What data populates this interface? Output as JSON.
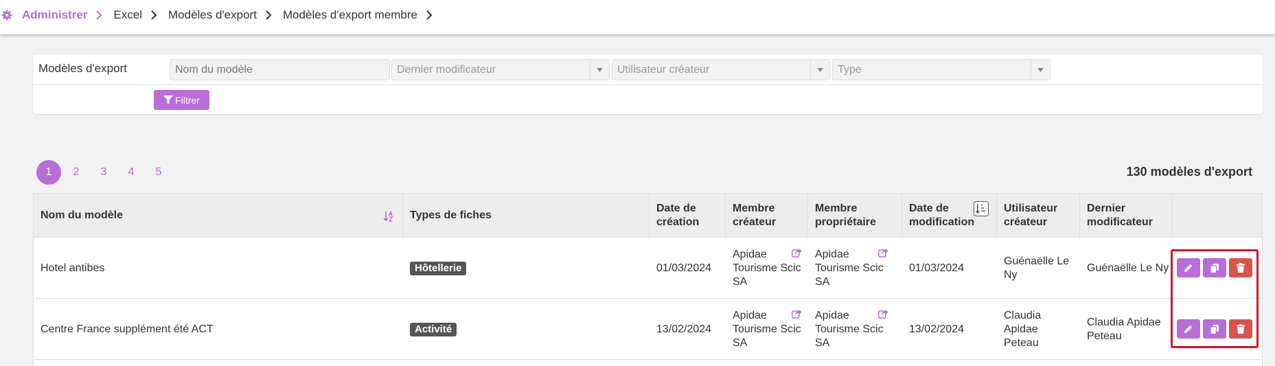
{
  "breadcrumb": {
    "items": [
      "Administrer",
      "Excel",
      "Modèles d'export",
      "Modèles d'export membre"
    ]
  },
  "filters": {
    "title": "Modèles d'export",
    "name_placeholder": "Nom du modèle",
    "last_modifier_placeholder": "Dernier modificateur",
    "creator_user_placeholder": "Utilisateur créateur",
    "type_placeholder": "Type",
    "filter_button": "Filtrer"
  },
  "pagination": {
    "pages": [
      "1",
      "2",
      "3",
      "4",
      "5"
    ],
    "current": "1",
    "total_label": "130 modèles d'export"
  },
  "table": {
    "headers": {
      "name": "Nom du modèle",
      "types": "Types de fiches",
      "created": "Date de création",
      "member_creator": "Membre créateur",
      "member_owner": "Membre propriétaire",
      "modified": "Date de modification",
      "user_creator": "Utilisateur créateur",
      "last_modifier": "Dernier modificateur"
    },
    "rows": [
      {
        "name": "Hotel antibes",
        "type": "Hôtellerie",
        "created": "01/03/2024",
        "member_creator": "Apidae Tourisme Scic SA",
        "member_owner": "Apidae Tourisme Scic SA",
        "modified": "01/03/2024",
        "user_creator": "Guénaëlle Le Ny",
        "last_modifier": "Guénaëlle Le Ny"
      },
      {
        "name": "Centre France supplément été ACT",
        "type": "Activité",
        "created": "13/02/2024",
        "member_creator": "Apidae Tourisme Scic SA",
        "member_owner": "Apidae Tourisme Scic SA",
        "modified": "13/02/2024",
        "user_creator": "Claudia Apidae Peteau",
        "last_modifier": "Claudia Apidae Peteau"
      }
    ]
  },
  "colors": {
    "accent": "#b86dd8",
    "danger": "#d9534f",
    "highlight": "#e00c25",
    "badge": "#555555"
  }
}
